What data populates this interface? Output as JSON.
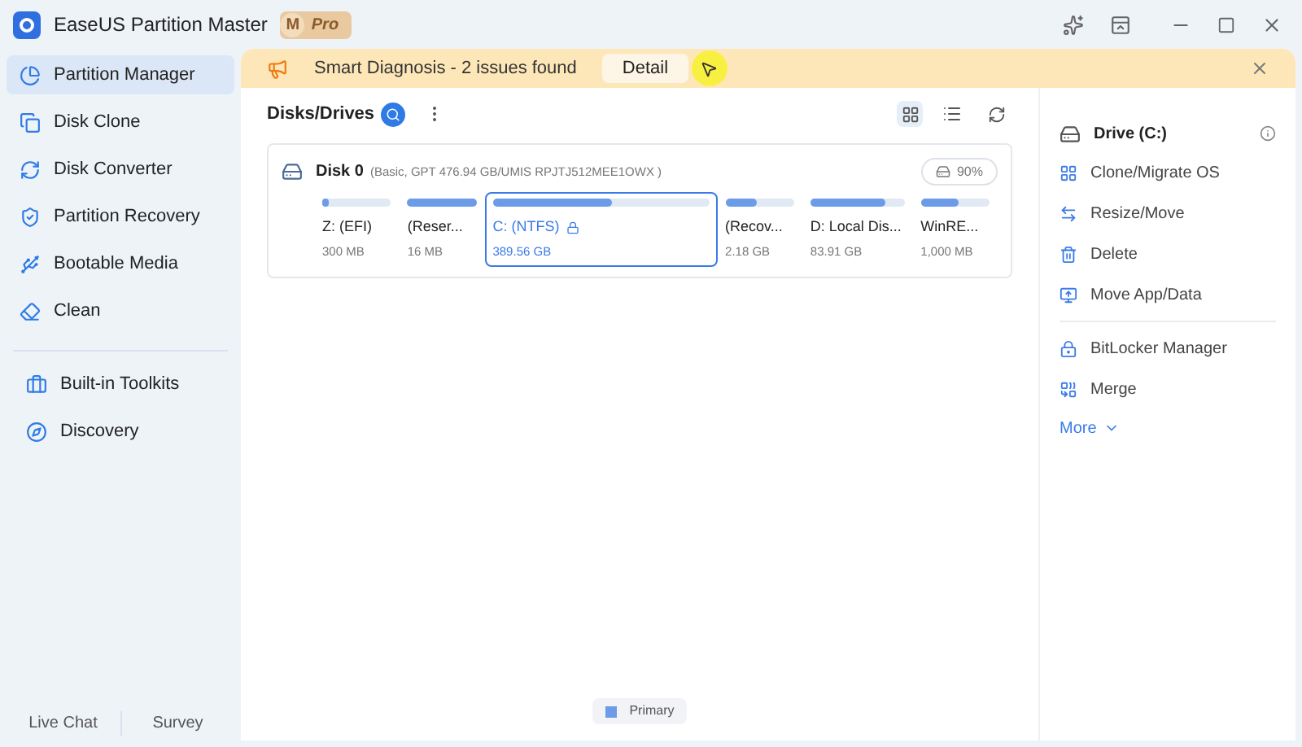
{
  "app": {
    "title": "EaseUS Partition Master",
    "badge_letter": "M",
    "badge": "Pro"
  },
  "sidebar": {
    "groups": [
      [
        {
          "label": "Partition Manager",
          "selected": true
        },
        {
          "label": "Disk Clone",
          "selected": false
        },
        {
          "label": "Disk Converter",
          "selected": false
        },
        {
          "label": "Partition Recovery",
          "selected": false
        },
        {
          "label": "Bootable Media",
          "selected": false
        },
        {
          "label": "Clean",
          "selected": false
        }
      ],
      [
        {
          "label": "Built-in Toolkits",
          "selected": false
        },
        {
          "label": "Discovery",
          "selected": false
        }
      ]
    ],
    "footer": [
      "Live Chat",
      "Survey"
    ]
  },
  "banner": {
    "text": "Smart Diagnosis - 2 issues found",
    "button": "Detail"
  },
  "disks": {
    "title": "Disks/Drives",
    "disk": {
      "name": "Disk 0",
      "info": "(Basic, GPT 476.94 GB/UMIS RPJTJ512MEE1OWX )",
      "usage": "90%",
      "partitions": [
        {
          "name": "Z: (EFI)",
          "size": "300 MB",
          "level": 0.1,
          "selected": false,
          "locked": false
        },
        {
          "name": "(Reser...",
          "size": "16 MB",
          "level": 1,
          "selected": false,
          "locked": false
        },
        {
          "name": "C: (NTFS)",
          "size": "389.56 GB",
          "level": 0.55,
          "selected": true,
          "locked": true
        },
        {
          "name": "(Recov...",
          "size": "2.18 GB",
          "level": 0.45,
          "selected": false,
          "locked": false
        },
        {
          "name": "D: Local Dis...",
          "size": "83.91 GB",
          "level": 0.8,
          "selected": false,
          "locked": false
        },
        {
          "name": "WinRE...",
          "size": "1,000 MB",
          "level": 0.55,
          "selected": false,
          "locked": false
        }
      ]
    },
    "legend": "Primary"
  },
  "actions": {
    "drive": "Drive (C:)",
    "groups": [
      [
        "Clone/Migrate OS",
        "Resize/Move",
        "Delete",
        "Move App/Data"
      ],
      [
        "BitLocker Manager",
        "Merge"
      ]
    ],
    "more": "More"
  }
}
